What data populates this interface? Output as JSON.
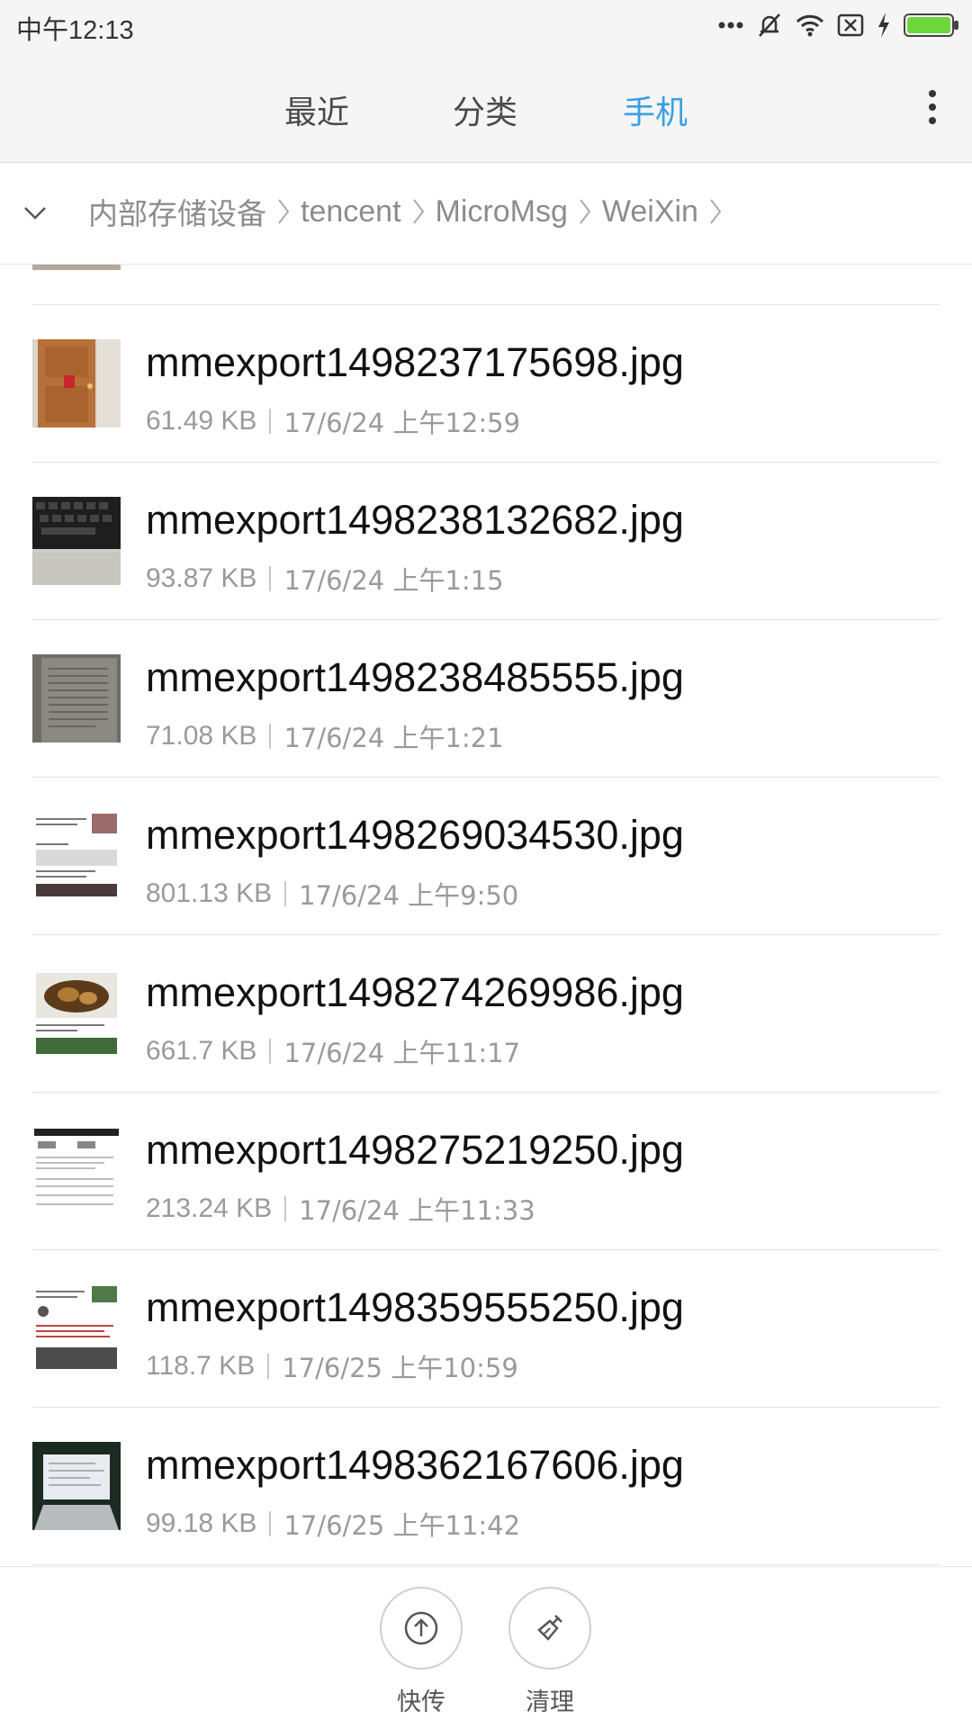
{
  "status_bar": {
    "time": "中午12:13"
  },
  "tabs": [
    {
      "label": "最近",
      "active": false
    },
    {
      "label": "分类",
      "active": false
    },
    {
      "label": "手机",
      "active": true
    }
  ],
  "accent_color": "#3a9fe6",
  "breadcrumb": [
    "内部存储设备",
    "tencent",
    "MicroMsg",
    "WeiXin"
  ],
  "files": [
    {
      "name": "mmexport1498237175698.jpg",
      "size": "61.49 KB",
      "date": "17/6/24 上午12:59",
      "thumb": "door"
    },
    {
      "name": "mmexport1498238132682.jpg",
      "size": "93.87 KB",
      "date": "17/6/24 上午1:15",
      "thumb": "keyboard"
    },
    {
      "name": "mmexport1498238485555.jpg",
      "size": "71.08 KB",
      "date": "17/6/24 上午1:21",
      "thumb": "paper"
    },
    {
      "name": "mmexport1498269034530.jpg",
      "size": "801.13 KB",
      "date": "17/6/24 上午9:50",
      "thumb": "article"
    },
    {
      "name": "mmexport1498274269986.jpg",
      "size": "661.7 KB",
      "date": "17/6/24 上午11:17",
      "thumb": "food"
    },
    {
      "name": "mmexport1498275219250.jpg",
      "size": "213.24 KB",
      "date": "17/6/24 上午11:33",
      "thumb": "stats"
    },
    {
      "name": "mmexport1498359555250.jpg",
      "size": "118.7 KB",
      "date": "17/6/25 上午10:59",
      "thumb": "news"
    },
    {
      "name": "mmexport1498362167606.jpg",
      "size": "99.18 KB",
      "date": "17/6/25 上午11:42",
      "thumb": "laptop"
    }
  ],
  "bottom_actions": [
    {
      "label": "快传",
      "icon": "upload-icon"
    },
    {
      "label": "清理",
      "icon": "broom-icon"
    }
  ]
}
